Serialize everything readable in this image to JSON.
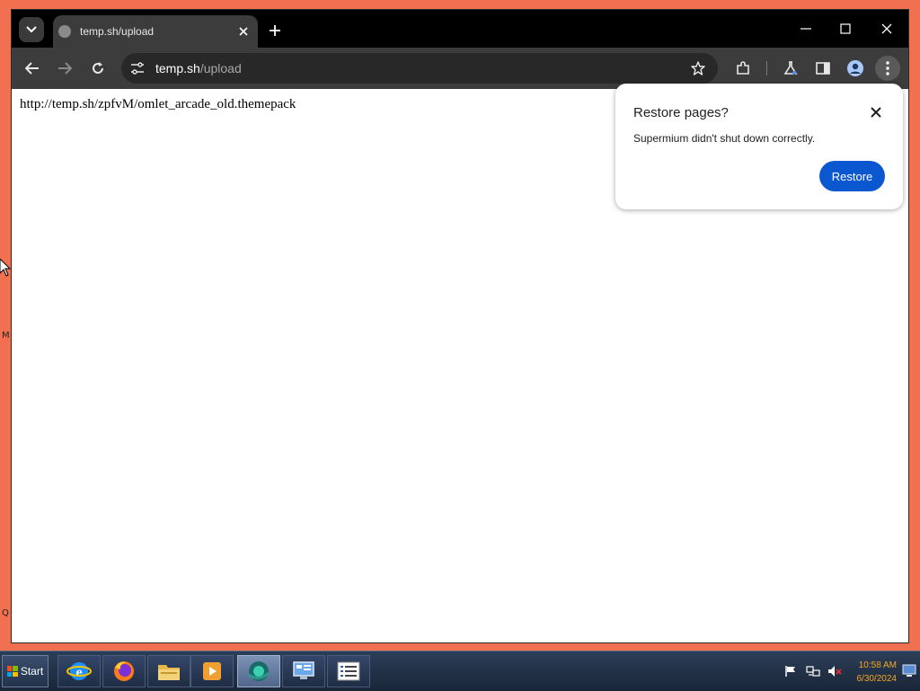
{
  "desktop": {
    "glyphs": [
      "M",
      "Q"
    ]
  },
  "browser": {
    "tab": {
      "title": "temp.sh/upload"
    },
    "address_bar": {
      "host": "temp.sh",
      "path": "/upload"
    },
    "page": {
      "text": "http://temp.sh/zpfvM/omlet_arcade_old.themepack"
    },
    "restore_bubble": {
      "title": "Restore pages?",
      "message": "Supermium didn't shut down correctly.",
      "restore_label": "Restore"
    }
  },
  "taskbar": {
    "start_label": "Start",
    "pinned_icons": [
      "internet-explorer-icon",
      "firefox-icon",
      "file-explorer-icon",
      "media-player-icon",
      "supermium-icon",
      "control-panel-icon",
      "task-list-icon"
    ],
    "active_icon": "supermium-icon",
    "tray_icons": [
      "action-center-flag-icon",
      "network-icon",
      "volume-muted-icon"
    ],
    "time": "10:58 AM",
    "date": "6/30/2024"
  },
  "colors": {
    "desktop_background": "#f07050",
    "restore_button": "#0b57d0",
    "clock_text": "#f5a623"
  }
}
